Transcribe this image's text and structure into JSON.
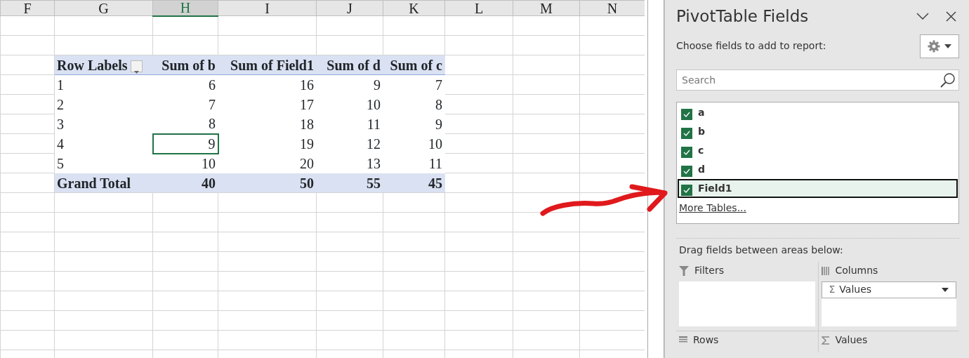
{
  "sheet": {
    "columns": [
      {
        "label": "F",
        "selected": false
      },
      {
        "label": "G",
        "selected": false
      },
      {
        "label": "H",
        "selected": true
      },
      {
        "label": "I",
        "selected": false
      },
      {
        "label": "J",
        "selected": false
      },
      {
        "label": "K",
        "selected": false
      },
      {
        "label": "L",
        "selected": false
      },
      {
        "label": "M",
        "selected": false
      },
      {
        "label": "N",
        "selected": false
      }
    ],
    "pivot": {
      "header": [
        "Row Labels",
        "Sum of b",
        "Sum of Field1",
        "Sum of d",
        "Sum of c"
      ],
      "rows": [
        {
          "label": "1",
          "values": [
            {
              "text": "6",
              "selected": false
            },
            {
              "text": "16",
              "selected": false
            },
            {
              "text": "9",
              "selected": false
            },
            {
              "text": "7",
              "selected": false
            }
          ]
        },
        {
          "label": "2",
          "values": [
            {
              "text": "7",
              "selected": false
            },
            {
              "text": "17",
              "selected": false
            },
            {
              "text": "10",
              "selected": false
            },
            {
              "text": "8",
              "selected": false
            }
          ]
        },
        {
          "label": "3",
          "values": [
            {
              "text": "8",
              "selected": false
            },
            {
              "text": "18",
              "selected": false
            },
            {
              "text": "11",
              "selected": false
            },
            {
              "text": "9",
              "selected": false
            }
          ]
        },
        {
          "label": "4",
          "values": [
            {
              "text": "9",
              "selected": true
            },
            {
              "text": "19",
              "selected": false
            },
            {
              "text": "12",
              "selected": false
            },
            {
              "text": "10",
              "selected": false
            }
          ]
        },
        {
          "label": "5",
          "values": [
            {
              "text": "10",
              "selected": false
            },
            {
              "text": "20",
              "selected": false
            },
            {
              "text": "13",
              "selected": false
            },
            {
              "text": "11",
              "selected": false
            }
          ]
        }
      ],
      "grand_total": {
        "label": "Grand Total",
        "values": [
          "40",
          "50",
          "55",
          "45"
        ]
      }
    }
  },
  "panel": {
    "title": "PivotTable Fields",
    "subtitle": "Choose fields to add to report:",
    "search": {
      "placeholder": "Search"
    },
    "fields": [
      {
        "name": "a",
        "checked": true,
        "selected": false
      },
      {
        "name": "b",
        "checked": true,
        "selected": false
      },
      {
        "name": "c",
        "checked": true,
        "selected": false
      },
      {
        "name": "d",
        "checked": true,
        "selected": false
      },
      {
        "name": "Field1",
        "checked": true,
        "selected": true
      }
    ],
    "more_link": "More Tables...",
    "drag_hint": "Drag fields between areas below:",
    "areas": [
      {
        "kind": "filters",
        "label": "Filters"
      },
      {
        "kind": "columns",
        "label": "Columns",
        "items": [
          {
            "symbol": "Σ",
            "label": "Values"
          }
        ]
      },
      {
        "kind": "rows",
        "label": "Rows"
      },
      {
        "kind": "values",
        "label": "Values"
      }
    ]
  }
}
